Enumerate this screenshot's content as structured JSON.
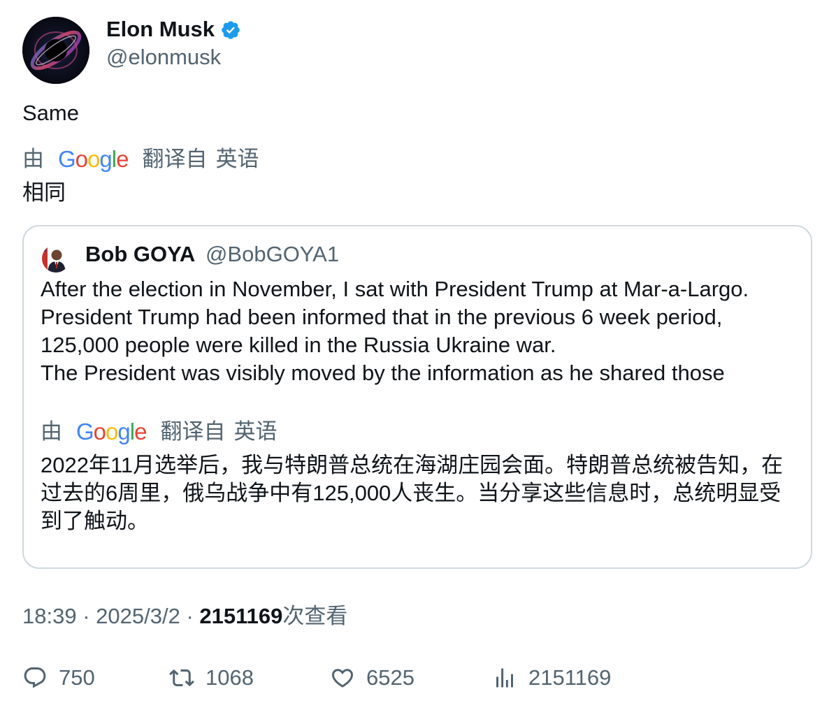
{
  "author": {
    "name": "Elon Musk",
    "handle": "@elonmusk",
    "verified": true,
    "avatar_icon": "black-hole-avatar"
  },
  "tweet": {
    "text": "Same",
    "translation": {
      "prefix": "由",
      "provider": "Google",
      "suffix": "翻译自",
      "language": "英语",
      "text": "相同"
    }
  },
  "quote": {
    "name": "Bob GOYA",
    "handle": "@BobGOYA1",
    "lines": [
      "After the election in November, I sat with President Trump at Mar-a-Largo.",
      "President Trump had been informed that in the previous 6 week period,",
      "125,000 people were killed in the Russia Ukraine war.",
      "The President was visibly moved by the information as he shared those"
    ],
    "translation": {
      "prefix": "由",
      "provider": "Google",
      "suffix": "翻译自",
      "language": "英语",
      "text": "2022年11月选举后，我与特朗普总统在海湖庄园会面。特朗普总统被告知，在过去的6周里，俄乌战争中有125,000人丧生。当分享这些信息时，总统明显受到了触动。"
    }
  },
  "meta": {
    "time": "18:39",
    "separator": "·",
    "date": "2025/3/2",
    "views": "2151169",
    "views_suffix": "次查看"
  },
  "actions": {
    "replies": "750",
    "retweets": "1068",
    "likes": "6525",
    "views": "2151169"
  },
  "colors": {
    "text": "#0f1419",
    "secondary": "#536471",
    "verified": "#1d9bf0",
    "border": "#cfd9de"
  }
}
